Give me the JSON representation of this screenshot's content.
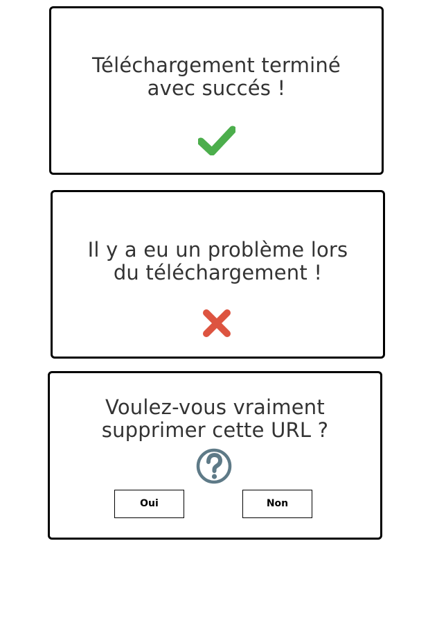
{
  "success_dialog": {
    "message_line1": "Téléchargement terminé",
    "message_line2": "avec succés !",
    "icon": "checkmark-icon",
    "icon_color": "#4cae4c"
  },
  "error_dialog": {
    "message_line1": "Il y a eu un problème lors",
    "message_line2": "du téléchargement !",
    "icon": "cross-icon",
    "icon_color": "#dd5440"
  },
  "confirm_dialog": {
    "message_line1": "Voulez-vous vraiment",
    "message_line2": "supprimer cette URL ?",
    "icon": "question-circle-icon",
    "icon_color": "#5e7a87",
    "yes_label": "Oui",
    "no_label": "Non"
  }
}
